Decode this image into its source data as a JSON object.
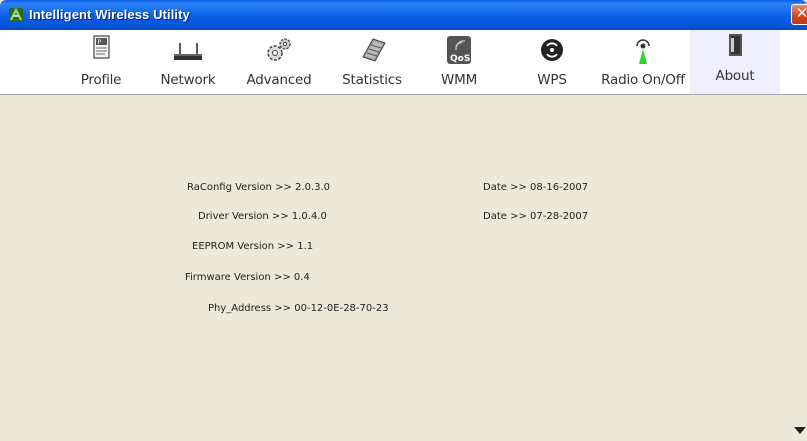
{
  "window": {
    "title": "Intelligent Wireless Utility",
    "close_label": "✕"
  },
  "toolbar": {
    "items": [
      {
        "label": "Profile",
        "icon": "profile-icon"
      },
      {
        "label": "Network",
        "icon": "network-icon"
      },
      {
        "label": "Advanced",
        "icon": "advanced-icon"
      },
      {
        "label": "Statistics",
        "icon": "statistics-icon"
      },
      {
        "label": "WMM",
        "icon": "wmm-qos-icon"
      },
      {
        "label": "WPS",
        "icon": "wps-icon"
      },
      {
        "label": "Radio On/Off",
        "icon": "radio-icon"
      },
      {
        "label": "About",
        "icon": "about-icon",
        "active": true
      }
    ]
  },
  "about": {
    "raconfig_label": "RaConfig Version >>",
    "raconfig_value": "2.0.3.0",
    "raconfig_date_label": "Date >>",
    "raconfig_date": "08-16-2007",
    "driver_label": "Driver Version >>",
    "driver_value": "1.0.4.0",
    "driver_date_label": "Date >>",
    "driver_date": "07-28-2007",
    "eeprom_label": "EEPROM Version >>",
    "eeprom_value": "1.1",
    "firmware_label": "Firmware Version >>",
    "firmware_value": "0.4",
    "phy_label": "Phy_Address >>",
    "phy_value": "00-12-0E-28-70-23"
  },
  "colors": {
    "titlebar": "#0b63ea",
    "panel_background": "#ece9d8",
    "toolbar_background": "#ffffff",
    "active_tab_background": "#eeeeff"
  }
}
